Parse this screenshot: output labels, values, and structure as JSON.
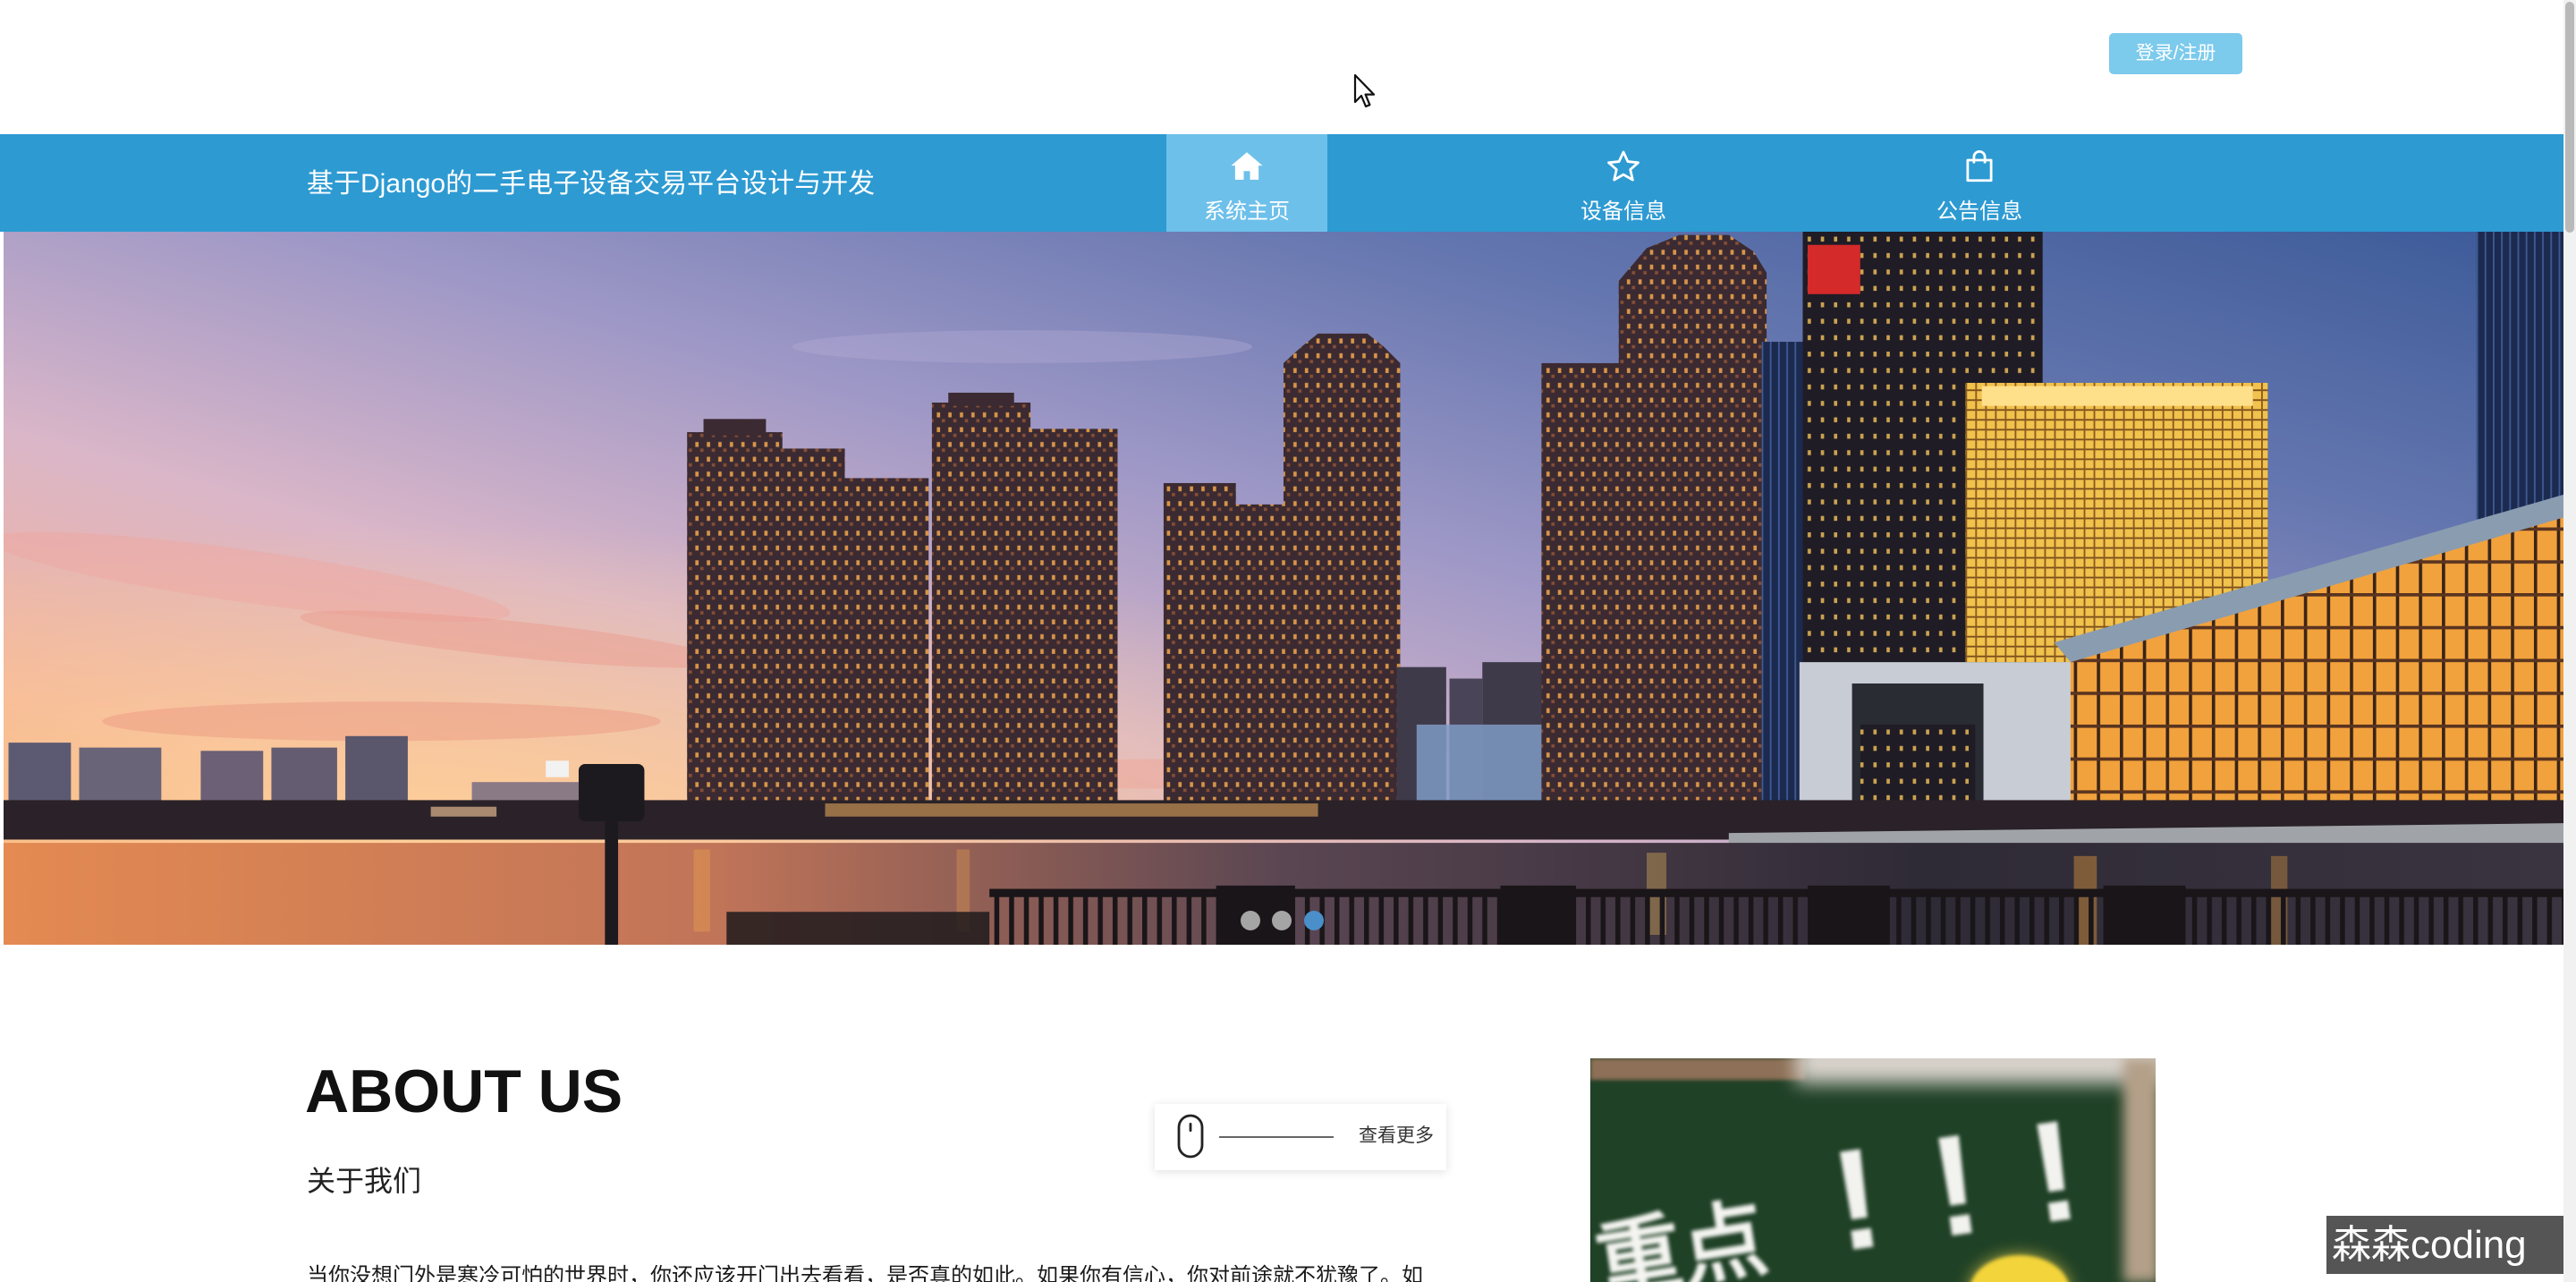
{
  "header": {
    "login_label": "登录/注册"
  },
  "nav": {
    "title": "基于Django的二手电子设备交易平台设计与开发",
    "items": [
      {
        "label": "系统主页",
        "icon": "home-icon",
        "active": true
      },
      {
        "label": "设备信息",
        "icon": "star-icon",
        "active": false
      },
      {
        "label": "公告信息",
        "icon": "shopping-bag-icon",
        "active": false
      }
    ]
  },
  "carousel": {
    "slide_count": 3,
    "active_slide": 3
  },
  "about": {
    "heading": "ABOUT US",
    "subheading": "关于我们",
    "more_label": "查看更多",
    "more_icon": "mouse-icon",
    "paragraph": "当你没想门外是寒冷可怕的世界时，你还应该开门出去看看，是否真的如此。如果你有信心，你对前途就不犹豫了。如"
  },
  "about_image": {
    "board_text": "重点",
    "marks": "!!!"
  },
  "watermark": {
    "text": "森森coding"
  },
  "colors": {
    "nav_bg": "#2d9ad2",
    "nav_active": "#6dc0ea",
    "login_bg": "#7ccaec",
    "dot_active": "#4a8fc9"
  }
}
